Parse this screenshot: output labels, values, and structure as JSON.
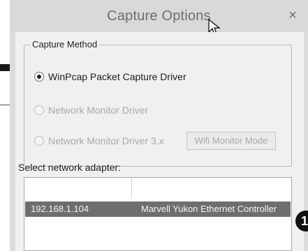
{
  "dialog": {
    "title": "Capture Options",
    "close_glyph": "×"
  },
  "capture_method": {
    "group_label": "Capture Method",
    "options": [
      {
        "label": "WinPcap Packet Capture Driver",
        "selected": true,
        "enabled": true
      },
      {
        "label": "Network Monitor Driver",
        "selected": false,
        "enabled": false
      },
      {
        "label": "Network Monitor Driver 3.x",
        "selected": false,
        "enabled": false
      }
    ],
    "wifi_button_label": "Wifi Monitor Mode"
  },
  "adapter": {
    "label": "Select network adapter:",
    "rows": [
      {
        "ip": "192.168.1.104",
        "name": "Marvell Yukon Ethernet Controller",
        "selected": true
      }
    ]
  },
  "marker": {
    "number": "1"
  },
  "colors": {
    "selection_bg": "#6e6e6e",
    "titlebar_bg": "#d9d9d9",
    "client_bg": "#f0f0f0"
  },
  "icons": {
    "cursor": "mouse-pointer-icon",
    "close": "close-icon"
  }
}
